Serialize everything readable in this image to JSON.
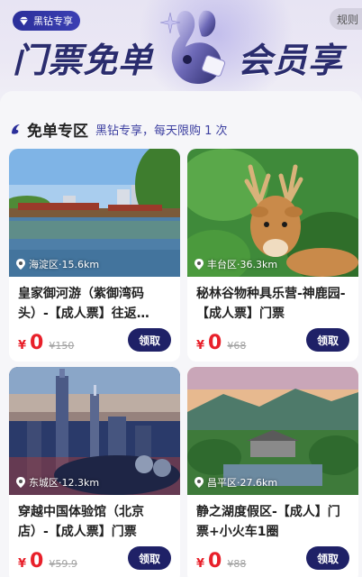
{
  "hero": {
    "badge": "黑钻专享",
    "rules": "规则",
    "title_left": "门票免单",
    "title_right": "会员享"
  },
  "section": {
    "title": "免单专区",
    "subtitle": "黑钻专享，每天限购 1 次"
  },
  "cards": [
    {
      "location": "海淀区·15.6km",
      "title": "皇家御河游（紫御湾码头）-【成人票】往返…",
      "currency": "¥",
      "price": "0",
      "original": "¥150",
      "button": "领取"
    },
    {
      "location": "丰台区·36.3km",
      "title": "秘林谷物种具乐营-神鹿园-【成人票】门票",
      "currency": "¥",
      "price": "0",
      "original": "¥68",
      "button": "领取"
    },
    {
      "location": "东城区·12.3km",
      "title": "穿越中国体验馆（北京店）-【成人票】门票",
      "currency": "¥",
      "price": "0",
      "original": "¥59.9",
      "button": "领取"
    },
    {
      "location": "昌平区·27.6km",
      "title": "静之湖度假区-【成人】门票+小火车1圈",
      "currency": "¥",
      "price": "0",
      "original": "¥88",
      "button": "领取"
    }
  ],
  "colors": {
    "accent": "#1f2167",
    "price": "#e8202a",
    "title": "#2a2c6e"
  }
}
